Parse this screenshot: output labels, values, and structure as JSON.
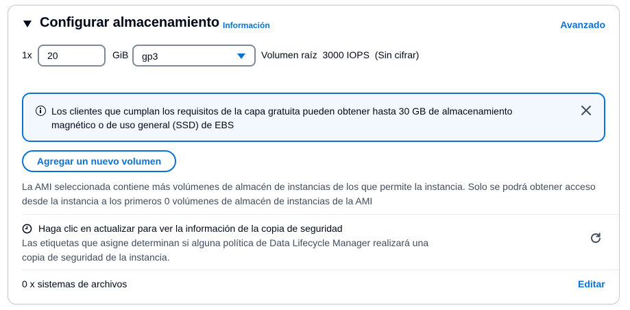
{
  "header": {
    "title": "Configurar almacenamiento",
    "info_link": "Información",
    "advanced_link": "Avanzado"
  },
  "volume": {
    "multiplier": "1x",
    "size_value": "20",
    "size_unit": "GiB",
    "type_selected": "gp3",
    "description": "Volumen raíz  3000 IOPS  (Sin cifrar)"
  },
  "alert": {
    "icon": "info-icon",
    "text": "Los clientes que cumplan los requisitos de la capa gratuita pueden obtener hasta 30 GB de almacenamiento magnético o de uso general (SSD) de EBS"
  },
  "add_volume_button": "Agregar un nuevo volumen",
  "ami_note": "La AMI seleccionada contiene más volúmenes de almacén de instancias de los que permite la instancia. Solo se podrá obtener acceso desde la instancia a los primeros 0 volúmenes de almacén de instancias de la AMI",
  "backup": {
    "icon": "clock-icon",
    "title": "Haga clic en actualizar para ver la información de la copia de seguridad",
    "subtitle": "Las etiquetas que asigne determinan si alguna política de Data Lifecycle Manager realizará una copia de seguridad de la instancia."
  },
  "file_systems": {
    "label": "0 x sistemas de archivos",
    "edit_link": "Editar"
  },
  "colors": {
    "accent": "#0972d3",
    "text": "#000716",
    "secondary_text": "#414d5c",
    "alert_bg": "#f2f8fd",
    "border": "#c6c6cd"
  }
}
